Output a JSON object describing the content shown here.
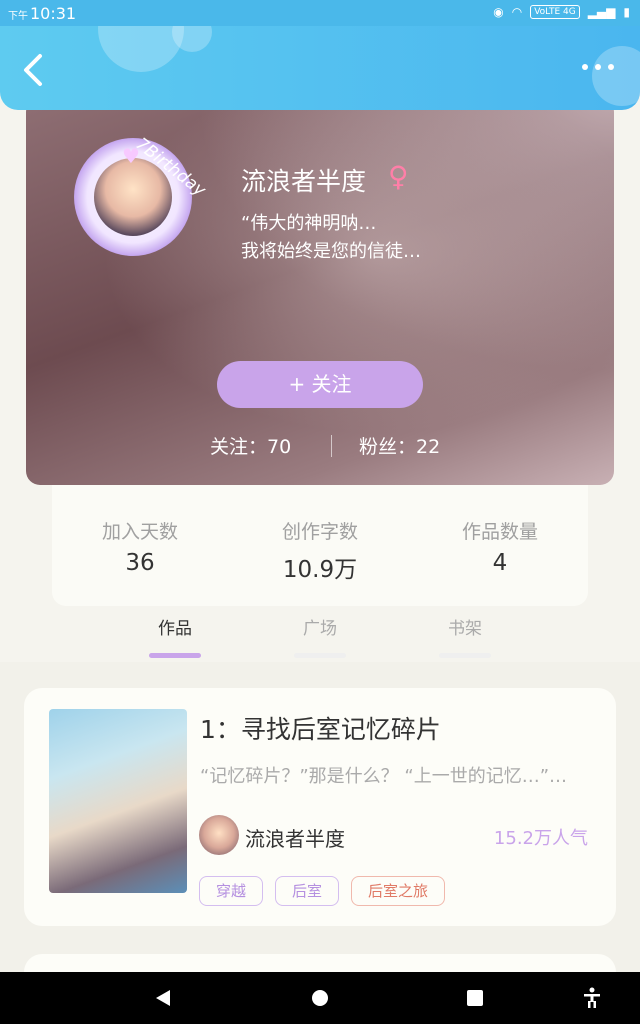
{
  "statusbar": {
    "ampm": "下午",
    "time": "10:31",
    "badges": "VoLTE 4G"
  },
  "header": {
    "back_icon": "back-arrow-icon",
    "more_icon": "more-dots-icon"
  },
  "profile": {
    "birthday_text": "7Birthday",
    "username": "流浪者半度",
    "gender_symbol": "♀",
    "bio_line1": "“伟大的神明呐…",
    "bio_line2": "我将始终是您的信徒…",
    "follow_label": "+   关注",
    "following": "关注：70",
    "fans": "粉丝：22"
  },
  "stats": [
    {
      "label": "加入天数",
      "value": "36"
    },
    {
      "label": "创作字数",
      "value": "10.9万"
    },
    {
      "label": "作品数量",
      "value": "4"
    }
  ],
  "tabs": [
    {
      "label": "作品",
      "active": true
    },
    {
      "label": "广场",
      "active": false
    },
    {
      "label": "书架",
      "active": false
    }
  ],
  "works": [
    {
      "title": "1：寻找后室记忆碎片",
      "desc": "“记忆碎片？”那是什么？ “上一世的记忆…”…",
      "author": "流浪者半度",
      "popularity": "15.2万人气",
      "tags": [
        "穿越",
        "后室",
        "后室之旅"
      ]
    }
  ],
  "colors": {
    "accent": "#c9a4ea",
    "header": "#4ab6ef"
  }
}
